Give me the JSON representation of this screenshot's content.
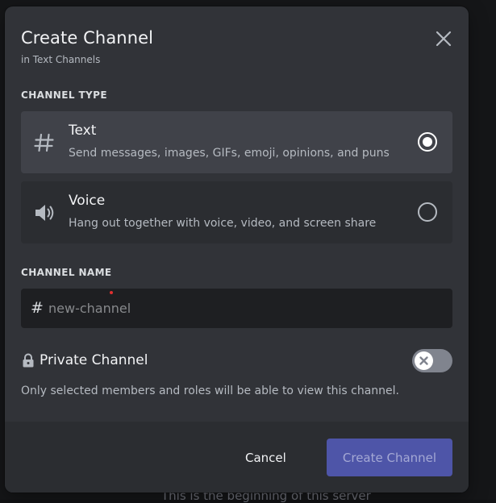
{
  "background": {
    "partial_text": "This is the beginning of this server"
  },
  "modal": {
    "title": "Create Channel",
    "subtitle": "in Text Channels",
    "close_icon": "close-icon"
  },
  "channel_type": {
    "label": "CHANNEL TYPE",
    "selected": "text",
    "options": [
      {
        "id": "text",
        "icon": "hash-icon",
        "title": "Text",
        "description": "Send messages, images, GIFs, emoji, opinions, and puns"
      },
      {
        "id": "voice",
        "icon": "speaker-icon",
        "title": "Voice",
        "description": "Hang out together with voice, video, and screen share"
      }
    ]
  },
  "channel_name": {
    "label": "CHANNEL NAME",
    "prefix": "#",
    "value": "",
    "placeholder": "new-channel"
  },
  "private_channel": {
    "icon": "lock-icon",
    "title": "Private Channel",
    "enabled": false,
    "description": "Only selected members and roles will be able to view this channel."
  },
  "footer": {
    "cancel_label": "Cancel",
    "create_label": "Create Channel"
  },
  "colors": {
    "modal_bg": "#313338",
    "selected_option_bg": "#404249",
    "input_bg": "#1e1f22",
    "brand_disabled": "#4e55a8"
  }
}
